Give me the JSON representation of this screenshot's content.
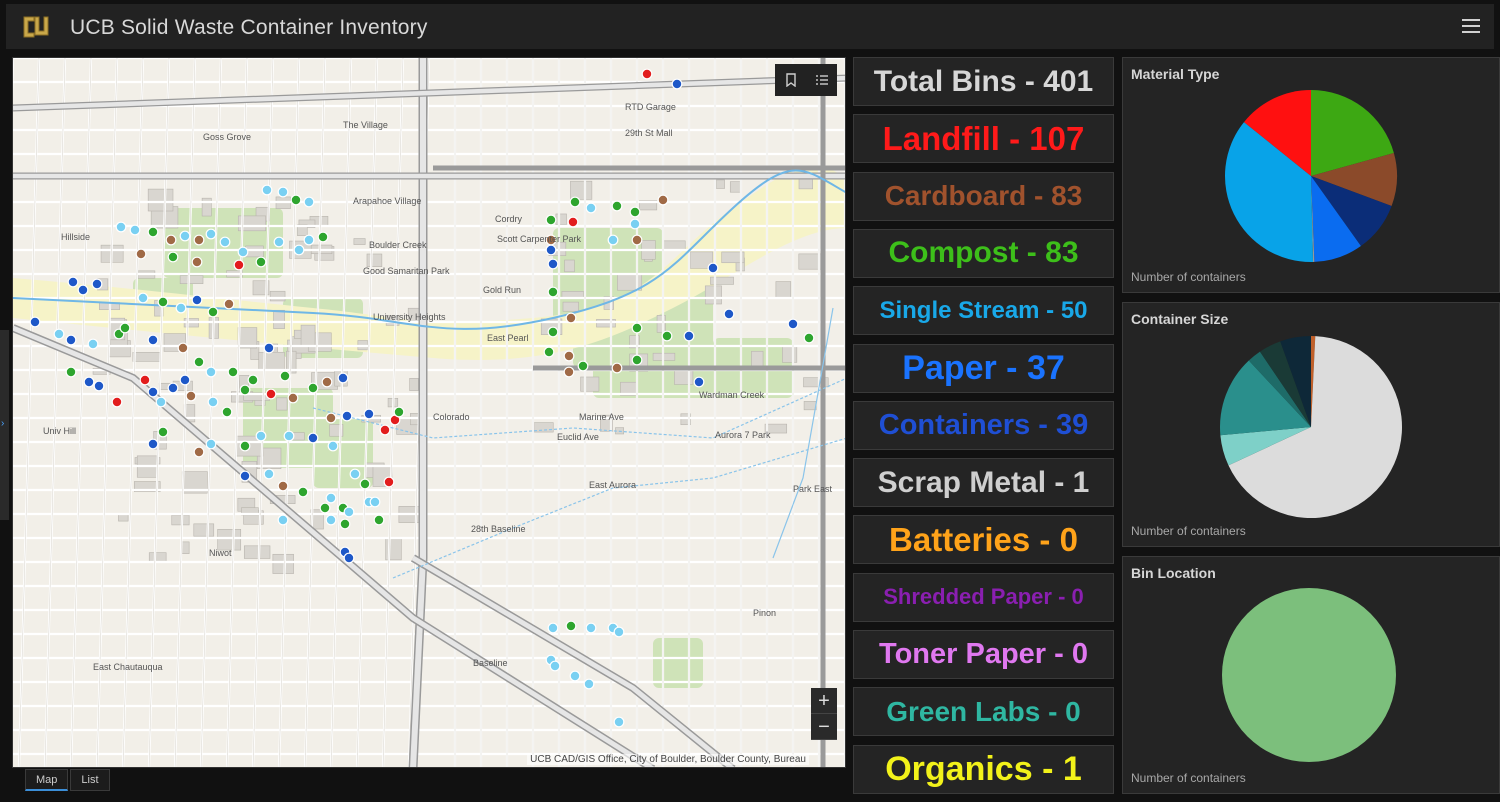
{
  "header": {
    "title": "UCB Solid Waste Container Inventory",
    "logo": "cu-logo",
    "menu_icon": "hamburger-menu-icon"
  },
  "map": {
    "attribution": "UCB CAD/GIS Office, City of Boulder, Boulder County, Bureau",
    "zoom_in": "+",
    "zoom_out": "−",
    "labels": [
      "Goss Grove",
      "The Village",
      "Arapahoe Village",
      "Cordry",
      "Scott Carpenter Park",
      "Boulder Creek",
      "Good Samaritan Park",
      "University Heights",
      "Gold Run",
      "East Pearl",
      "Colorado",
      "Wardman Creek",
      "Aurora 7 Park",
      "East Aurora",
      "Park East",
      "28th Baseline",
      "Niwot",
      "Pinon",
      "East Chautauqua",
      "Hillside",
      "Univ Hill",
      "29th St Mall",
      "RTD Garage",
      "Marine Ave",
      "Euclid Ave",
      "Baseline"
    ]
  },
  "map_tabs": [
    {
      "label": "Map",
      "active": true
    },
    {
      "label": "List",
      "active": false
    }
  ],
  "counts": [
    {
      "label": "Total Bins - 401",
      "color": "#d7d7d7",
      "size": 30
    },
    {
      "label": "Landfill - 107",
      "color": "#ff1a1a",
      "size": 33
    },
    {
      "label": "Cardboard - 83",
      "color": "#a0522d",
      "size": 28
    },
    {
      "label": "Compost - 83",
      "color": "#3dbf1a",
      "size": 30
    },
    {
      "label": "Single Stream - 50",
      "color": "#19a8e8",
      "size": 24
    },
    {
      "label": "Paper - 37",
      "color": "#1a73ff",
      "size": 34
    },
    {
      "label": "Containers - 39",
      "color": "#1f4fd4",
      "size": 29
    },
    {
      "label": "Scrap Metal - 1",
      "color": "#cfcfcf",
      "size": 30
    },
    {
      "label": "Batteries - 0",
      "color": "#ffa31a",
      "size": 33
    },
    {
      "label": "Shredded Paper - 0",
      "color": "#8a1fb0",
      "size": 22
    },
    {
      "label": "Toner Paper - 0",
      "color": "#e078f0",
      "size": 29
    },
    {
      "label": "Green Labs - 0",
      "color": "#2fb7a2",
      "size": 28
    },
    {
      "label": "Organics - 1",
      "color": "#f2f21a",
      "size": 34
    }
  ],
  "charts": [
    {
      "title": "Material Type",
      "footer": "Number of containers",
      "slices": [
        {
          "value": 83,
          "color": "#3da813"
        },
        {
          "value": 40,
          "color": "#8b4a2a"
        },
        {
          "value": 38,
          "color": "#0b2d78"
        },
        {
          "value": 37,
          "color": "#0a6cf0"
        },
        {
          "value": 1,
          "color": "#999999"
        },
        {
          "value": 145,
          "color": "#08a3e8"
        },
        {
          "value": 57,
          "color": "#ff1010"
        }
      ]
    },
    {
      "title": "Container Size",
      "footer": "Number of containers",
      "slices": [
        {
          "value": 3,
          "color": "#c0602a"
        },
        {
          "value": 270,
          "color": "#dcdcdc"
        },
        {
          "value": 22,
          "color": "#7ed0c8"
        },
        {
          "value": 58,
          "color": "#2a8f8c"
        },
        {
          "value": 10,
          "color": "#1e6b68"
        },
        {
          "value": 16,
          "color": "#1a3a36"
        },
        {
          "value": 22,
          "color": "#0e2838"
        }
      ]
    },
    {
      "title": "Bin Location",
      "footer": "Number of containers",
      "slices": [
        {
          "value": 401,
          "color": "#7cbf7c"
        }
      ]
    }
  ]
}
